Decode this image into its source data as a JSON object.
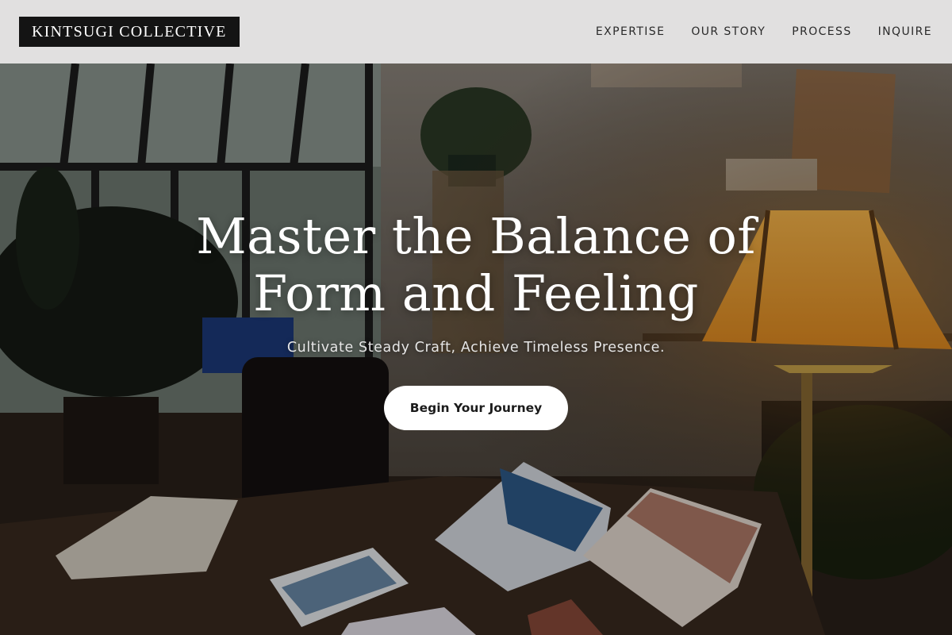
{
  "brand": {
    "name": "KINTSUGI COLLECTIVE"
  },
  "nav": {
    "items": [
      {
        "label": "EXPERTISE"
      },
      {
        "label": "OUR STORY"
      },
      {
        "label": "PROCESS"
      },
      {
        "label": "INQUIRE"
      }
    ]
  },
  "hero": {
    "title_line1": "Master the Balance of",
    "title_line2": "Form and Feeling",
    "subtitle": "Cultivate Steady Craft, Achieve Timeless Presence.",
    "cta_label": "Begin Your Journey"
  },
  "colors": {
    "header_bg": "#f0f0f0",
    "logo_bg": "#141414",
    "cta_bg": "#ffffff",
    "text_on_image": "#ffffff"
  }
}
